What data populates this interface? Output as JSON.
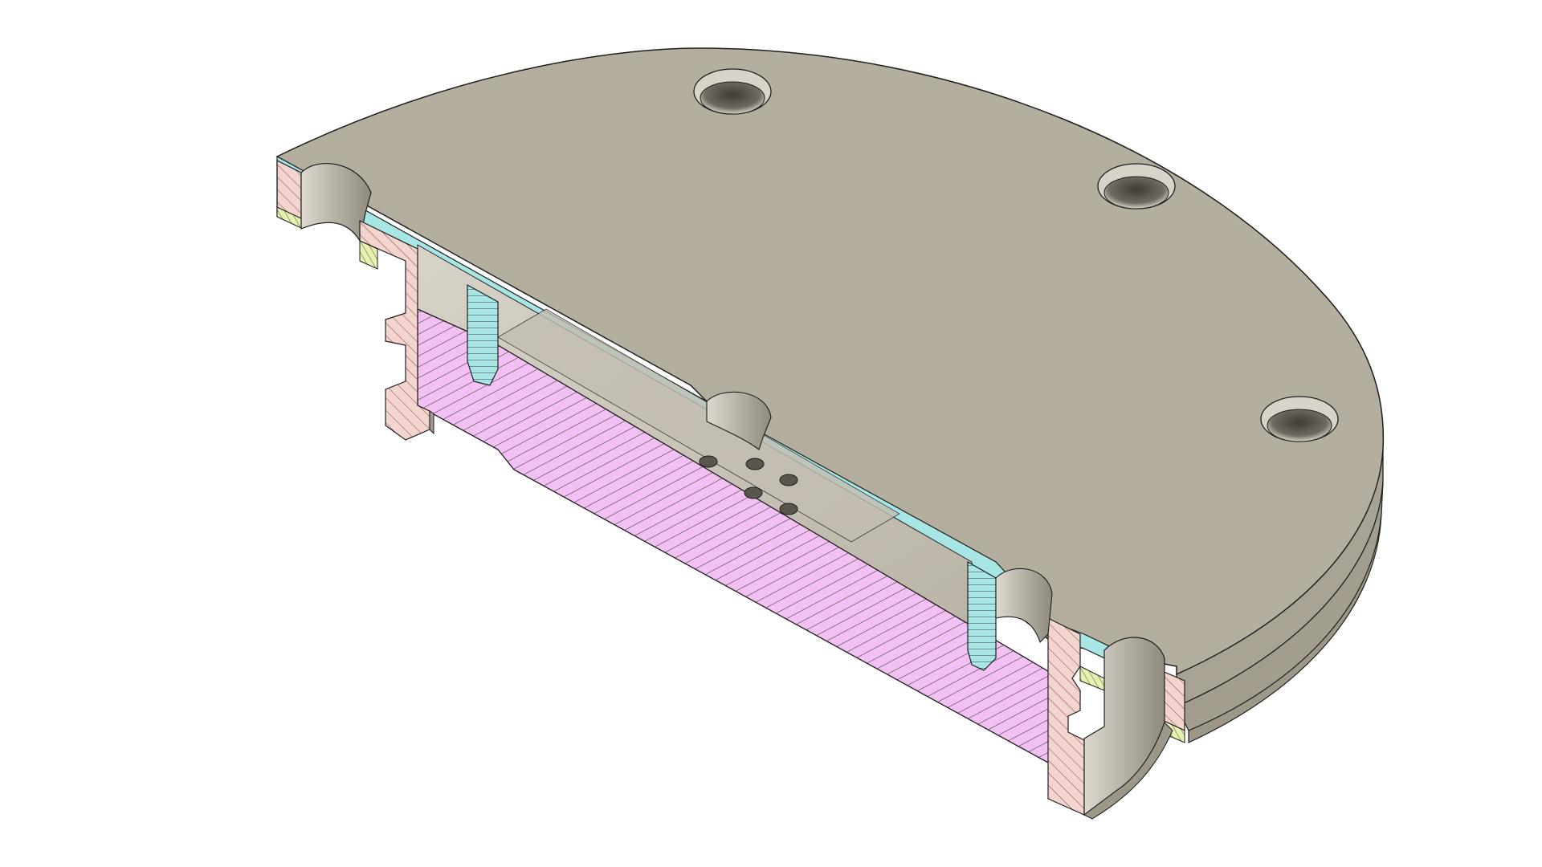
{
  "viewport": {
    "background": "#ffffff",
    "label": ""
  },
  "model": {
    "view": "section-view",
    "colors": {
      "top_face": "#b4ae9f",
      "side_face": "#a9a394",
      "inner_face": "#c9c4b7",
      "edge": "#1e1e1e",
      "hole_inner": "#55524b",
      "hole_rim": "#d8d4c9",
      "section_cyan": "#a8e6e6",
      "section_magenta": "#f2c0f2",
      "section_salmon": "#f3d5cf",
      "section_yellow": "#e5f2b0",
      "hatch": "#2a2a2a"
    },
    "holes_top_count": 4,
    "small_holes_count": 5
  }
}
